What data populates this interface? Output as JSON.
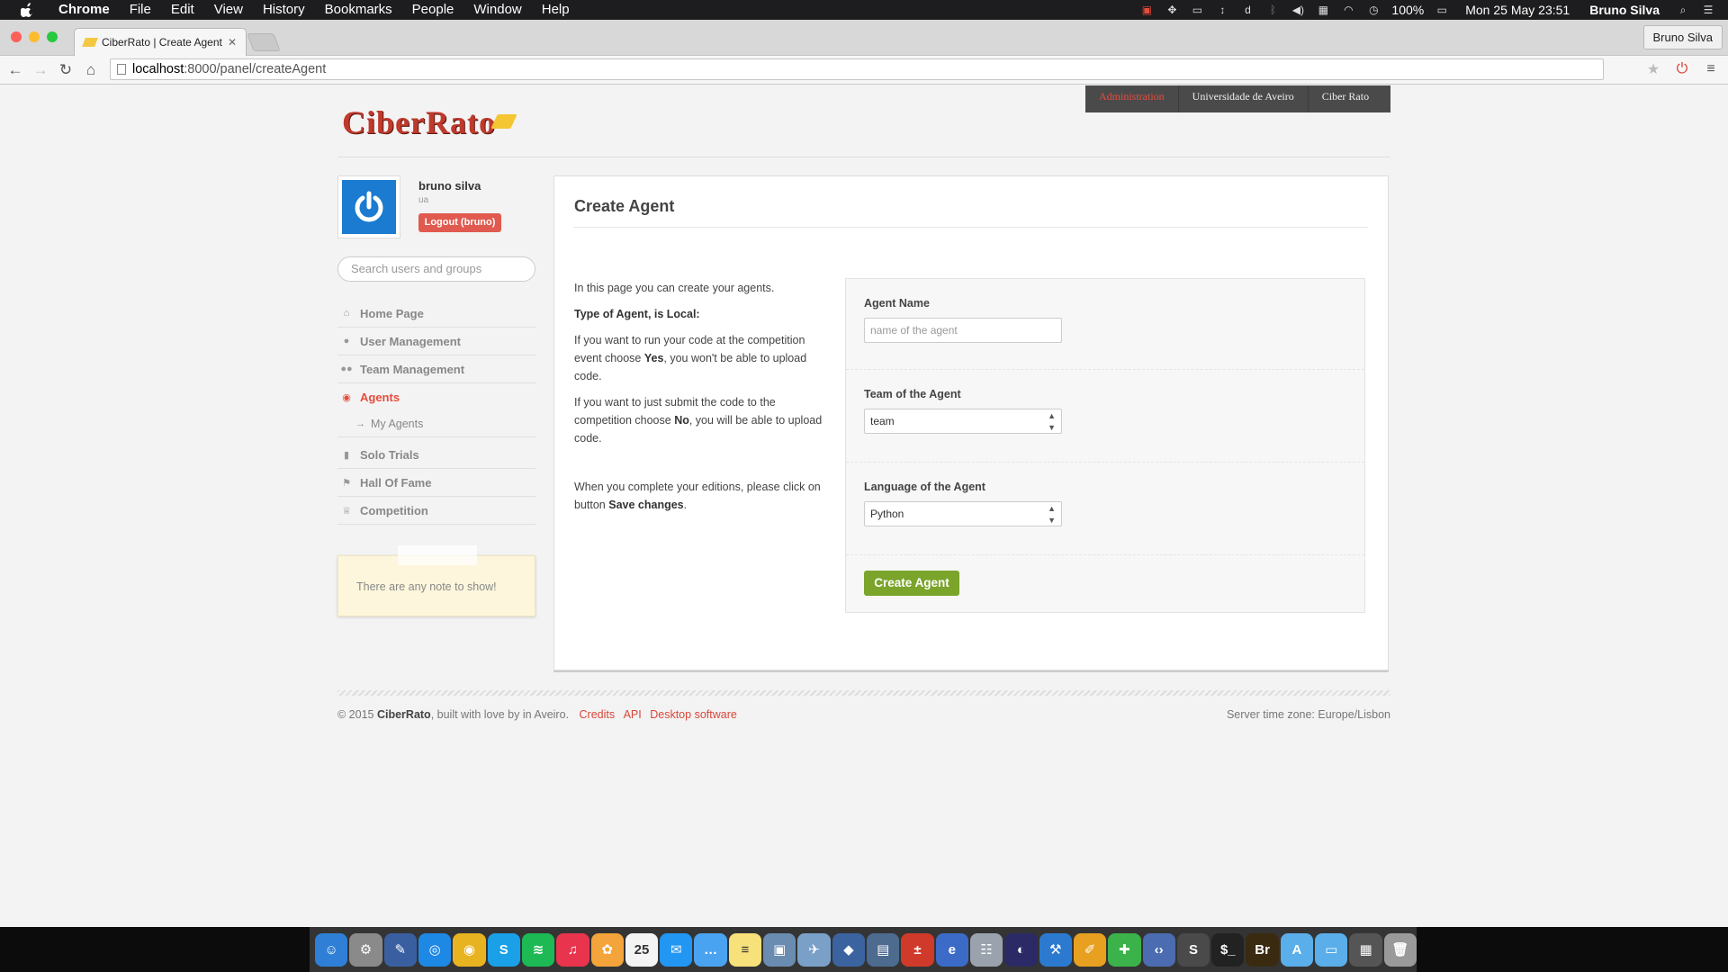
{
  "menubar": {
    "app": "Chrome",
    "items": [
      "File",
      "Edit",
      "View",
      "History",
      "Bookmarks",
      "People",
      "Window",
      "Help"
    ],
    "battery": "100%",
    "datetime": "Mon 25 May  23:51",
    "user": "Bruno Silva"
  },
  "browser": {
    "tab_title": "CiberRato | Create Agent",
    "profile": "Bruno Silva",
    "url_host": "localhost",
    "url_path": ":8000/panel/createAgent"
  },
  "site": {
    "logo": "CiberRato",
    "topnav": [
      {
        "label": "Administration",
        "active": true
      },
      {
        "label": "Universidade de Aveiro",
        "active": false
      },
      {
        "label": "Ciber Rato",
        "active": false
      }
    ]
  },
  "sidebar": {
    "user_name": "bruno silva",
    "user_org": "ua",
    "logout_label": "Logout (bruno)",
    "search_placeholder": "Search users and groups",
    "menu": [
      {
        "label": "Home Page",
        "icon": "home-icon",
        "glyph": "⌂"
      },
      {
        "label": "User Management",
        "icon": "user-icon",
        "glyph": "●"
      },
      {
        "label": "Team Management",
        "icon": "users-icon",
        "glyph": "●●"
      },
      {
        "label": "Agents",
        "icon": "eye-icon",
        "glyph": "◉",
        "active": true
      },
      {
        "label": "My Agents",
        "icon": "arrow-right-icon",
        "glyph": "→",
        "sub": true
      },
      {
        "label": "Solo Trials",
        "icon": "lock-icon",
        "glyph": "▮"
      },
      {
        "label": "Hall Of Fame",
        "icon": "flag-icon",
        "glyph": "⚑"
      },
      {
        "label": "Competition",
        "icon": "trophy-icon",
        "glyph": "♕"
      }
    ],
    "note": "There are any note to show!"
  },
  "main": {
    "title": "Create Agent",
    "intro": "In this page you can create your agents.",
    "type_text": "Type of Agent, is Local:",
    "para1_a": "If you want to run your code at the competition event choose ",
    "para1_b": "Yes",
    "para1_c": ", you won't be able to upload code.",
    "para2_a": "If you want to just submit the code to the competition choose ",
    "para2_b": "No",
    "para2_c": ", you will be able to upload code.",
    "para3_a": "When you complete your editions, please click on button ",
    "para3_b": "Save changes",
    "para3_c": ".",
    "form": {
      "name_label": "Agent Name",
      "name_placeholder": "name of the agent",
      "team_label": "Team of the Agent",
      "team_value": "team",
      "language_label": "Language of the Agent",
      "language_value": "Python",
      "submit_label": "Create Agent"
    }
  },
  "footer": {
    "copyright_a": "© 2015 ",
    "brand": "CiberRato",
    "copyright_b": ", built with love by in Aveiro.",
    "links": [
      "Credits",
      "API",
      "Desktop software"
    ],
    "timezone": "Server time zone: Europe/Lisbon"
  },
  "dock": {
    "apps": [
      {
        "name": "finder",
        "color": "#2f7fd6",
        "glyph": "☺"
      },
      {
        "name": "system-preferences",
        "color": "#8a8a8a",
        "glyph": "⚙"
      },
      {
        "name": "xcode-simulator",
        "color": "#3a5fa0",
        "glyph": "✎"
      },
      {
        "name": "safari",
        "color": "#1e88e5",
        "glyph": "◎"
      },
      {
        "name": "chrome",
        "color": "#e8b320",
        "glyph": "◉"
      },
      {
        "name": "skype",
        "color": "#1aa0e6",
        "glyph": "S"
      },
      {
        "name": "spotify",
        "color": "#1db954",
        "glyph": "≋"
      },
      {
        "name": "itunes",
        "color": "#e8344c",
        "glyph": "♫"
      },
      {
        "name": "photos",
        "color": "#f3a43a",
        "glyph": "✿"
      },
      {
        "name": "calendar",
        "color": "#f4f4f4",
        "glyph": "25"
      },
      {
        "name": "messenger",
        "color": "#2196f3",
        "glyph": "✉"
      },
      {
        "name": "messages",
        "color": "#4aa3f0",
        "glyph": "…"
      },
      {
        "name": "notes",
        "color": "#f7e17a",
        "glyph": "≡"
      },
      {
        "name": "preview",
        "color": "#6a8cb0",
        "glyph": "▣"
      },
      {
        "name": "airdrop",
        "color": "#7aa0c8",
        "glyph": "✈"
      },
      {
        "name": "virtualbox",
        "color": "#3a63a0",
        "glyph": "◆"
      },
      {
        "name": "screenshot",
        "color": "#4d6b8f",
        "glyph": "▤"
      },
      {
        "name": "calculator",
        "color": "#d03a2a",
        "glyph": "±"
      },
      {
        "name": "safari-beta",
        "color": "#3b6bc7",
        "glyph": "e"
      },
      {
        "name": "database",
        "color": "#9aa3ad",
        "glyph": "☷"
      },
      {
        "name": "eclipse",
        "color": "#2c2a66",
        "glyph": "◐"
      },
      {
        "name": "xcode",
        "color": "#2c7ad0",
        "glyph": "⚒"
      },
      {
        "name": "slingshot",
        "color": "#e8a020",
        "glyph": "✐"
      },
      {
        "name": "puzzle",
        "color": "#3bb34a",
        "glyph": "✚"
      },
      {
        "name": "code-editor",
        "color": "#4b6cb0",
        "glyph": "‹›"
      },
      {
        "name": "sublime",
        "color": "#4a4a4a",
        "glyph": "S"
      },
      {
        "name": "terminal",
        "color": "#222",
        "glyph": "$_"
      },
      {
        "name": "bridge",
        "color": "#3a2a10",
        "glyph": "Br"
      },
      {
        "name": "applications-folder",
        "color": "#5aaeea",
        "glyph": "A"
      },
      {
        "name": "documents-folder",
        "color": "#5aaeea",
        "glyph": "▭"
      },
      {
        "name": "monitor",
        "color": "#555",
        "glyph": "▦"
      },
      {
        "name": "trash",
        "color": "#9a9a9a",
        "glyph": "🗑"
      }
    ]
  }
}
